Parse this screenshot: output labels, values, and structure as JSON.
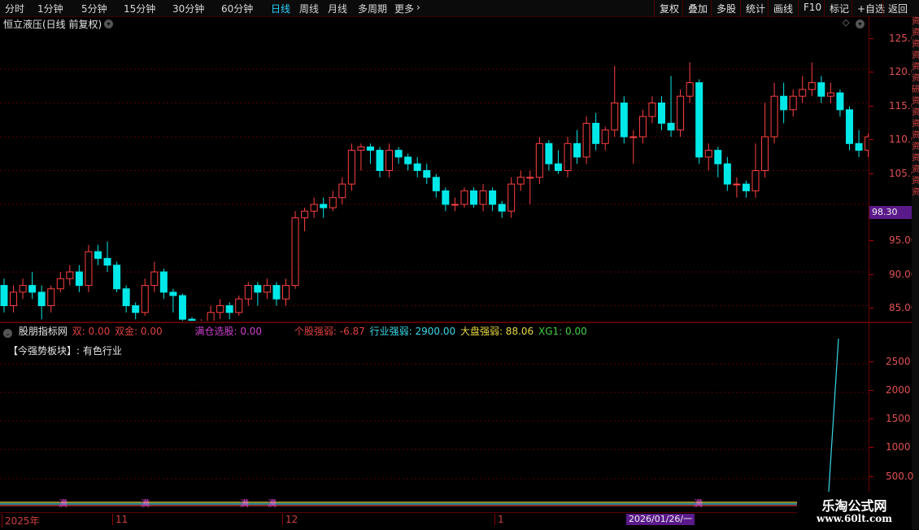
{
  "topbar": {
    "periods": [
      "分时",
      "1分钟",
      "5分钟",
      "15分钟",
      "30分钟",
      "60分钟",
      "日线",
      "周线",
      "月线",
      "多周期",
      "更多"
    ],
    "active_period": "日线",
    "more_chevron": "›",
    "right_buttons": [
      "复权",
      "叠加",
      "多股",
      "统计",
      "画线",
      "F10",
      "标记",
      "+自选",
      "返回"
    ]
  },
  "stock": {
    "title": "恒立液压(日线 前复权)",
    "last_price": "98.30"
  },
  "price_axis": {
    "labels": [
      "125.0",
      "120.0",
      "115.0",
      "110.0",
      "105.0",
      "95.00",
      "90.00",
      "85.00"
    ]
  },
  "indicator": {
    "toggle_icon": "⌄",
    "name": "股朋指标网",
    "items": [
      {
        "text": "双: 0.00",
        "color": "#e04040"
      },
      {
        "text": "双金: 0.00",
        "color": "#e04040"
      },
      {
        "text": "满仓选股: 0.00",
        "color": "#d040d0"
      },
      {
        "text": "个股强弱: -6.87",
        "color": "#e04040"
      },
      {
        "text": "行业强弱: 2900.00",
        "color": "#3ad8e8"
      },
      {
        "text": "大盘强弱: 88.06",
        "color": "#e8d840"
      },
      {
        "text": "XG1: 0.00",
        "color": "#40d040"
      }
    ],
    "note": "【今强势板块】: 有色行业",
    "axis_labels": [
      "2500",
      "2000",
      "1500",
      "1000",
      "500.0"
    ],
    "marker_char": "满"
  },
  "dates": {
    "labels": [
      "2025年",
      "11",
      "12",
      "1"
    ],
    "cursor": "2026/01/26/一"
  },
  "right_strip": [
    "资",
    "资",
    "资",
    "资",
    "资",
    "资",
    "研",
    "资",
    "资",
    "资",
    "资",
    "资",
    "资",
    "资",
    "资",
    "资"
  ],
  "watermark": {
    "line1": "乐淘公式网",
    "line2": "www.60lt.com"
  },
  "colors": {
    "up": "#ff4040",
    "down": "#00e8e8",
    "grid": "#5a0000"
  },
  "chart_data": {
    "type": "candlestick",
    "title": "恒立液压(日线 前复权)",
    "ylim": [
      84,
      127
    ],
    "y_ticks": [
      125,
      120,
      115,
      110,
      105,
      95,
      90,
      85
    ],
    "x_labels": [
      "2025年",
      "11",
      "12",
      "1"
    ],
    "candles": [
      [
        93,
        90,
        94,
        89
      ],
      [
        90,
        92,
        93,
        89
      ],
      [
        92,
        93,
        94,
        91
      ],
      [
        93,
        92,
        95,
        91
      ],
      [
        92,
        90,
        93,
        88
      ],
      [
        90,
        92.5,
        93,
        89
      ],
      [
        92.5,
        94,
        95,
        92
      ],
      [
        94,
        95,
        96,
        93
      ],
      [
        95,
        93,
        96,
        92
      ],
      [
        93,
        98,
        99,
        92
      ],
      [
        98,
        97,
        99,
        96
      ],
      [
        97,
        96,
        99.5,
        95
      ],
      [
        96,
        92.5,
        96.5,
        92
      ],
      [
        92.5,
        90,
        93,
        89
      ],
      [
        90,
        89,
        90.5,
        88
      ],
      [
        89,
        93,
        94,
        88.5
      ],
      [
        93,
        95,
        96.5,
        92
      ],
      [
        95,
        92,
        95.5,
        91
      ],
      [
        92,
        91.5,
        92.5,
        89
      ],
      [
        91.5,
        88,
        91.8,
        87.5
      ],
      [
        88,
        86,
        88.3,
        85
      ],
      [
        86,
        86.2,
        88,
        85.5
      ],
      [
        86.2,
        89,
        90,
        86
      ],
      [
        89,
        90,
        91,
        88
      ],
      [
        90,
        89,
        90.5,
        88
      ],
      [
        89,
        91,
        91.5,
        88.5
      ],
      [
        91,
        93,
        93.5,
        90
      ],
      [
        93,
        92,
        93.5,
        90
      ],
      [
        92,
        93,
        94,
        91
      ],
      [
        93,
        91,
        93.5,
        90
      ],
      [
        91,
        93,
        94,
        90
      ],
      [
        93,
        103,
        104,
        92.5
      ],
      [
        103,
        104,
        104.5,
        101
      ],
      [
        104,
        105,
        106,
        103
      ],
      [
        105,
        104.5,
        106,
        103
      ],
      [
        104.5,
        106,
        107,
        104
      ],
      [
        106,
        108,
        109,
        105
      ],
      [
        108,
        113,
        114,
        107
      ],
      [
        113,
        113.5,
        114,
        110
      ],
      [
        113.5,
        113,
        114,
        111
      ],
      [
        113,
        110,
        113.5,
        109
      ],
      [
        110,
        113,
        114,
        109
      ],
      [
        113,
        112,
        113.5,
        111
      ],
      [
        112,
        111,
        112.5,
        110
      ],
      [
        111,
        110,
        112,
        109
      ],
      [
        110,
        109,
        111,
        108
      ],
      [
        109,
        107,
        109.5,
        106
      ],
      [
        107,
        105,
        107.5,
        104
      ],
      [
        105,
        105,
        106,
        104
      ],
      [
        105,
        107,
        107.5,
        104.5
      ],
      [
        107,
        105,
        107.5,
        104.5
      ],
      [
        105,
        107,
        108,
        104
      ],
      [
        107,
        105,
        107.5,
        104
      ],
      [
        105,
        104,
        105.5,
        103
      ],
      [
        104,
        108,
        109,
        103
      ],
      [
        108,
        109,
        110,
        107
      ],
      [
        109,
        109,
        110,
        105
      ],
      [
        109,
        114,
        115,
        108
      ],
      [
        114,
        111,
        114.5,
        110
      ],
      [
        111,
        110,
        113,
        109.5
      ],
      [
        110,
        114,
        115,
        109
      ],
      [
        114,
        112,
        116,
        111
      ],
      [
        112,
        117,
        118,
        111
      ],
      [
        117,
        114,
        118.5,
        113
      ],
      [
        114,
        116,
        116.5,
        113
      ],
      [
        116,
        120,
        125.5,
        115
      ],
      [
        120,
        115,
        121,
        114
      ],
      [
        115,
        115,
        116,
        111
      ],
      [
        115,
        118,
        119,
        114
      ],
      [
        118,
        120,
        121,
        117
      ],
      [
        120,
        117,
        121,
        116
      ],
      [
        117,
        116,
        124,
        115
      ],
      [
        116,
        121,
        122,
        115
      ],
      [
        121,
        123,
        126,
        120
      ],
      [
        123,
        112,
        123.5,
        111
      ],
      [
        112,
        113,
        114,
        110
      ],
      [
        113,
        111,
        113.5,
        109
      ],
      [
        111,
        108,
        112,
        107
      ],
      [
        108,
        108,
        109,
        106
      ],
      [
        108,
        107,
        108.5,
        106
      ],
      [
        107,
        110,
        114,
        106
      ],
      [
        110,
        115,
        120,
        109
      ],
      [
        115,
        121,
        123,
        114
      ],
      [
        121,
        119,
        123,
        117
      ],
      [
        119,
        121,
        122,
        118
      ],
      [
        121,
        122,
        124,
        120
      ],
      [
        122,
        123,
        126,
        121
      ],
      [
        123,
        121,
        124,
        120
      ],
      [
        121,
        121.5,
        123,
        120
      ],
      [
        121.5,
        119,
        122,
        118
      ],
      [
        119,
        114,
        119.5,
        113
      ],
      [
        114,
        113,
        116,
        112
      ],
      [
        113,
        115,
        115.5,
        112
      ],
      [
        115,
        114,
        116,
        113
      ],
      [
        114,
        113,
        115,
        112
      ],
      [
        113,
        111,
        114,
        110
      ],
      [
        111,
        106,
        111.5,
        105
      ],
      [
        106,
        105,
        106.5,
        103
      ],
      [
        105,
        106,
        107,
        104.5
      ],
      [
        106,
        107,
        108,
        105
      ]
    ]
  }
}
